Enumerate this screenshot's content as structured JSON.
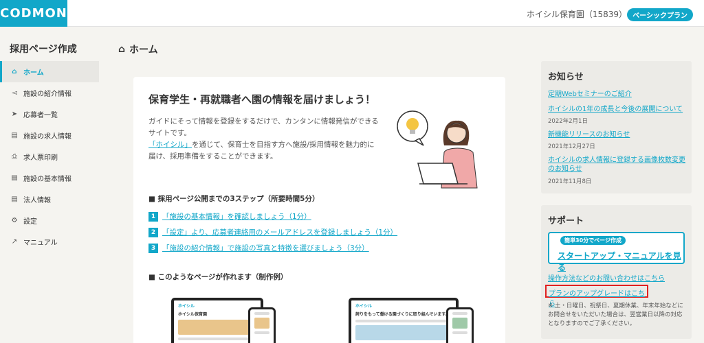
{
  "header": {
    "logo": "CODMON",
    "org": "ホイシル保育園（15839）",
    "plan_badge": "ベーシックプラン"
  },
  "sidebar": {
    "title": "採用ページ作成",
    "items": [
      {
        "label": "ホーム",
        "icon": "home-icon"
      },
      {
        "label": "施設の紹介情報",
        "icon": "megaphone-icon"
      },
      {
        "label": "応募者一覧",
        "icon": "send-icon"
      },
      {
        "label": "施設の求人情報",
        "icon": "document-icon"
      },
      {
        "label": "求人票印刷",
        "icon": "printer-icon"
      },
      {
        "label": "施設の基本情報",
        "icon": "document-icon"
      },
      {
        "label": "法人情報",
        "icon": "document-icon"
      },
      {
        "label": "設定",
        "icon": "gear-icon"
      },
      {
        "label": "マニュアル",
        "icon": "external-link-icon"
      }
    ]
  },
  "main": {
    "page_title": "ホーム",
    "headline": "保育学生・再就職者へ園の情報を届けましょう！",
    "intro_line1": "ガイドにそって情報を登録をするだけで、カンタンに情報発信ができるサイトです。",
    "intro_link": "「ホイシル」",
    "intro_line2": "を通じて、保育士を目指す方へ施設/採用情報を魅力的に届け、採用準備をすることができます。",
    "steps_title": "■ 採用ページ公開までの3ステップ（所要時間5分）",
    "steps": [
      {
        "num": "1",
        "text": "「施設の基本情報」を確認しましょう（1分）"
      },
      {
        "num": "2",
        "text": "「設定」より、応募者連絡用のメールアドレスを登録しましょう（1分）"
      },
      {
        "num": "3",
        "text": "「施設の紹介情報」で施設の写真と特徴を選びましょう（3分）"
      }
    ],
    "examples_title": "■ このようなページが作れます（制作例）",
    "mock1_brand": "ホイシル",
    "mock1_title": "ホイシル保育園",
    "mock2_brand": "ホイシル",
    "mock2_title": "誇りをもって働ける園づくりに取り組んでいます。"
  },
  "news": {
    "title": "お知らせ",
    "items": [
      {
        "text": "定期Webセミナーのご紹介",
        "date": ""
      },
      {
        "text": "ホイシルの1年の成長と今後の展開について",
        "date": "2022年2月1日"
      },
      {
        "text": "新機能リリースのお知らせ",
        "date": "2021年12月27日"
      },
      {
        "text": "ホイシルの求人情報に登録する画像枚数変更のお知らせ",
        "date": "2021年11月8日"
      }
    ]
  },
  "support": {
    "title": "サポート",
    "startup_tag": "簡単30分でページ作成",
    "startup_label": "スタートアップ・マニュアルを見る",
    "contact_link": "操作方法などのお問い合わせはこちら",
    "upgrade_link": "プランのアップグレードはこちら",
    "note": "※ 土・日曜日、祝祭日、夏期休業、年末年始などにお問合せをいただいた場合は、翌営業日以降の対応となりますのでご了承ください。"
  },
  "colors": {
    "accent": "#12a7c9",
    "highlight": "#e02020"
  }
}
